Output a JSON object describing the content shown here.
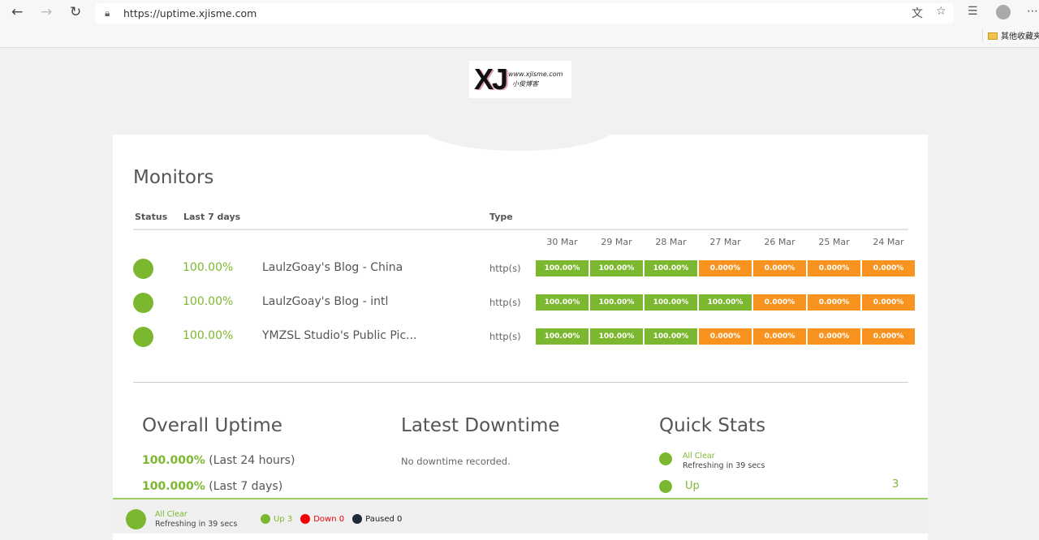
{
  "browser": {
    "url": "https://uptime.xjisme.com",
    "bookmark_folder": "其他收藏夹"
  },
  "logo": {
    "mark": "XJ",
    "site": "www.xjisme.com",
    "subtitle": "小俊博客"
  },
  "monitors": {
    "title": "Monitors",
    "headers": {
      "status": "Status",
      "last7": "Last 7 days",
      "type": "Type"
    },
    "dates": [
      "30 Mar",
      "29 Mar",
      "28 Mar",
      "27 Mar",
      "26 Mar",
      "25 Mar",
      "24 Mar"
    ],
    "rows": [
      {
        "uptime": "100.00%",
        "name": "LaulzGoay's Blog - China",
        "type": "http(s)",
        "days": [
          "100.00%",
          "100.00%",
          "100.00%",
          "0.000%",
          "0.000%",
          "0.000%",
          "0.000%"
        ]
      },
      {
        "uptime": "100.00%",
        "name": "LaulzGoay's Blog - intl",
        "type": "http(s)",
        "days": [
          "100.00%",
          "100.00%",
          "100.00%",
          "100.00%",
          "0.000%",
          "0.000%",
          "0.000%"
        ]
      },
      {
        "uptime": "100.00%",
        "name": "YMZSL Studio's Public Pic...",
        "type": "http(s)",
        "days": [
          "100.00%",
          "100.00%",
          "100.00%",
          "0.000%",
          "0.000%",
          "0.000%",
          "0.000%"
        ]
      }
    ]
  },
  "overall": {
    "title": "Overall Uptime",
    "items": [
      {
        "value": "100.000%",
        "label": "(Last 24 hours)"
      },
      {
        "value": "100.000%",
        "label": "(Last 7 days)"
      }
    ]
  },
  "downtime": {
    "title": "Latest Downtime",
    "text": "No downtime recorded."
  },
  "quick": {
    "title": "Quick Stats",
    "status": "All Clear",
    "refresh": "Refreshing in 39 secs",
    "up_label": "Up",
    "up_count": "3"
  },
  "footer": {
    "status": "All Clear",
    "refresh": "Refreshing in 39 secs",
    "up": "Up 3",
    "down": "Down 0",
    "paused": "Paused 0"
  },
  "colors": {
    "up": "#7cb82f",
    "na": "#f7931e",
    "down": "#e00",
    "paused": "#1f2a36"
  }
}
